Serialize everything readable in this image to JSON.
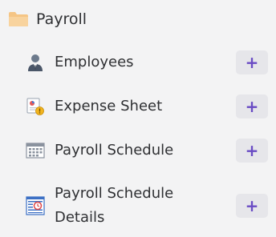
{
  "group": {
    "title": "Payroll",
    "icon": "folder-icon"
  },
  "items": [
    {
      "label": "Employees",
      "icon": "employee-icon",
      "add_label": "+"
    },
    {
      "label": "Expense Sheet",
      "icon": "expense-sheet-icon",
      "add_label": "+"
    },
    {
      "label": "Payroll Schedule",
      "icon": "calendar-icon",
      "add_label": "+"
    },
    {
      "label": "Payroll Schedule\nDetails",
      "icon": "schedule-details-icon",
      "add_label": "+"
    }
  ],
  "colors": {
    "background": "#f3f3f4",
    "button_bg": "#e6e6ea",
    "accent": "#6a4cc4",
    "folder": "#f5c585"
  }
}
